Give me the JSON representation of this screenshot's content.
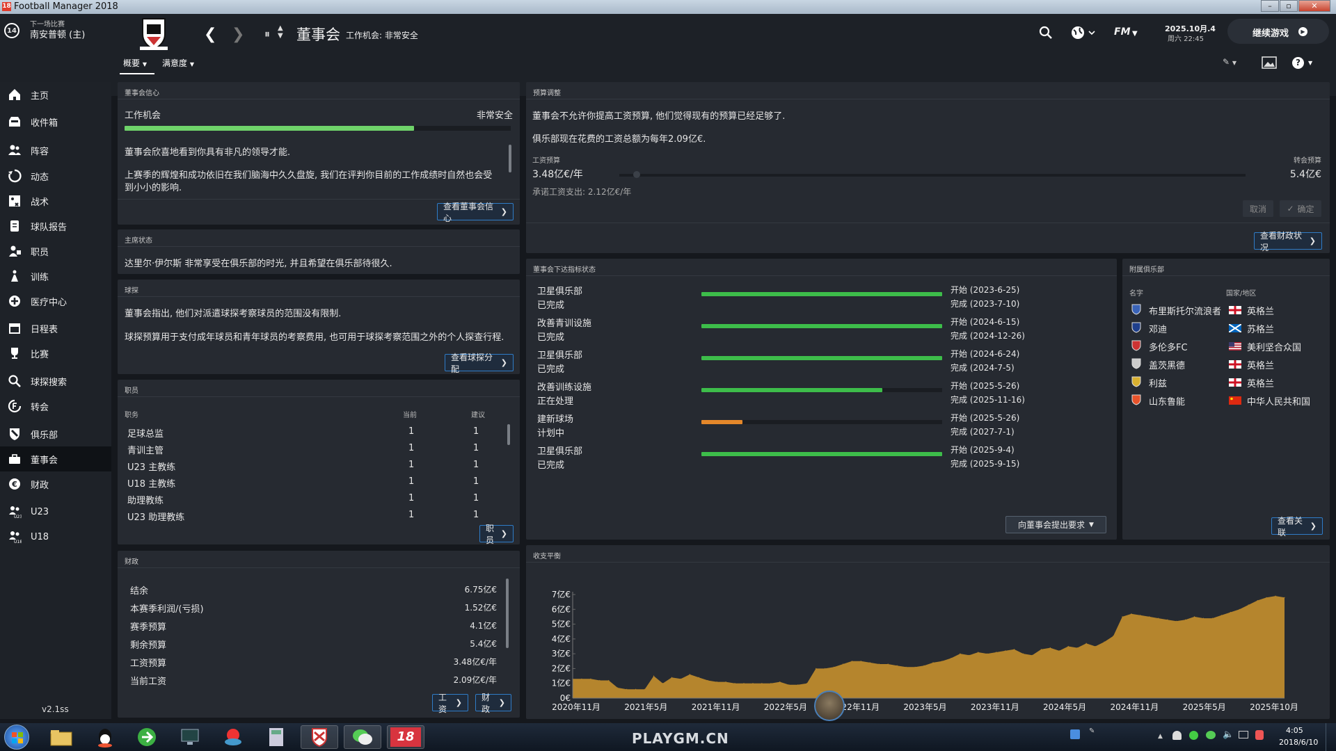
{
  "window": {
    "title": "Football Manager 2018",
    "logo": "18"
  },
  "header": {
    "next_match_label": "下一场比赛",
    "next_match_team": "南安普顿 (主)",
    "next_match_days": "14",
    "page_title": "董事会",
    "page_subtitle": "工作机会: 非常安全",
    "date": "2025.10月.4",
    "time": "周六 22:45",
    "fm_label": "FM",
    "continue_label": "继续游戏",
    "tabs": [
      {
        "label": "概要"
      },
      {
        "label": "满意度"
      }
    ]
  },
  "sidebar": {
    "items": [
      {
        "label": "主页",
        "icon": "home-icon"
      },
      {
        "label": "收件箱",
        "icon": "inbox-icon"
      },
      {
        "label": "阵容",
        "icon": "squad-icon"
      },
      {
        "label": "动态",
        "icon": "dynamics-icon"
      },
      {
        "label": "战术",
        "icon": "tactics-icon"
      },
      {
        "label": "球队报告",
        "icon": "report-icon"
      },
      {
        "label": "职员",
        "icon": "staff-icon"
      },
      {
        "label": "训练",
        "icon": "training-icon"
      },
      {
        "label": "医疗中心",
        "icon": "medical-icon"
      },
      {
        "label": "日程表",
        "icon": "calendar-icon"
      },
      {
        "label": "比赛",
        "icon": "trophy-icon"
      },
      {
        "label": "球探搜索",
        "icon": "search-icon"
      },
      {
        "label": "转会",
        "icon": "transfer-icon"
      },
      {
        "label": "俱乐部",
        "icon": "club-icon"
      },
      {
        "label": "董事会",
        "icon": "board-icon"
      },
      {
        "label": "财政",
        "icon": "finance-icon"
      },
      {
        "label": "U23",
        "icon": "u23-icon"
      },
      {
        "label": "U18",
        "icon": "u18-icon"
      }
    ],
    "version": "v2.1ss"
  },
  "confidence": {
    "title": "董事会信心",
    "job_label": "工作机会",
    "job_value": "非常安全",
    "progress": 0.75,
    "text1": "董事会欣喜地看到你具有非凡的领导才能.",
    "text2a": "上赛季的辉煌和成功依旧在我们脑海中久久盘旋, 我们在评判你目前的工作成绩时自然也会受",
    "text2b": "到小小的影响.",
    "button": "查看董事会信心"
  },
  "chairman": {
    "title": "主席状态",
    "text": "达里尔·伊尔斯 非常享受在俱乐部的时光, 并且希望在俱乐部待很久."
  },
  "scouting": {
    "title": "球探",
    "text1": "董事会指出, 他们对派遣球探考察球员的范围没有限制.",
    "text2": "球探预算用于支付成年球员和青年球员的考察费用, 也可用于球探考察范围之外的个人探查行程.",
    "button": "查看球探分配"
  },
  "staff": {
    "title": "职员",
    "col_role": "职务",
    "col_current": "当前",
    "col_suggest": "建议",
    "rows": [
      {
        "role": "足球总监",
        "current": "1",
        "suggest": "1"
      },
      {
        "role": "青训主管",
        "current": "1",
        "suggest": "1"
      },
      {
        "role": "U23 主教练",
        "current": "1",
        "suggest": "1"
      },
      {
        "role": "U18 主教练",
        "current": "1",
        "suggest": "1"
      },
      {
        "role": "助理教练",
        "current": "1",
        "suggest": "1"
      },
      {
        "role": "U23 助理教练",
        "current": "1",
        "suggest": "1"
      }
    ],
    "button": "职员"
  },
  "finance": {
    "title": "财政",
    "rows": [
      {
        "label": "结余",
        "value": "6.75亿€"
      },
      {
        "label": "本赛季利润/(亏损)",
        "value": "1.52亿€"
      },
      {
        "label": "赛季预算",
        "value": "4.1亿€"
      },
      {
        "label": "剩余预算",
        "value": "5.4亿€"
      },
      {
        "label": "工资预算",
        "value": "3.48亿€/年"
      },
      {
        "label": "当前工资",
        "value": "2.09亿€/年"
      }
    ],
    "btn_wage": "工资",
    "btn_finance": "财政"
  },
  "budget": {
    "title": "预算调整",
    "text1": "董事会不允许你提高工资预算, 他们觉得现有的预算已经足够了.",
    "text2": "俱乐部现在花费的工资总额为每年2.09亿€.",
    "wage_label": "工资预算",
    "transfer_label": "转会预算",
    "wage_value": "3.48亿€/年",
    "transfer_value": "5.4亿€",
    "committed": "承诺工资支出: 2.12亿€/年",
    "cancel": "取消",
    "confirm": "确定",
    "button": "查看财政状况"
  },
  "objectives": {
    "title": "董事会下达指标状态",
    "items": [
      {
        "name": "卫星俱乐部",
        "status": "已完成",
        "start": "开始 (2023-6-25)",
        "end": "完成 (2023-7-10)",
        "progress": 1.0,
        "color": "#3dbd4a"
      },
      {
        "name": "改善青训设施",
        "status": "已完成",
        "start": "开始 (2024-6-15)",
        "end": "完成 (2024-12-26)",
        "progress": 1.0,
        "color": "#3dbd4a"
      },
      {
        "name": "卫星俱乐部",
        "status": "已完成",
        "start": "开始 (2024-6-24)",
        "end": "完成 (2024-7-5)",
        "progress": 1.0,
        "color": "#3dbd4a"
      },
      {
        "name": "改善训练设施",
        "status": "正在处理",
        "start": "开始 (2025-5-26)",
        "end": "完成 (2025-11-16)",
        "progress": 0.75,
        "color": "#3dbd4a"
      },
      {
        "name": "建新球场",
        "status": "计划中",
        "start": "开始 (2025-5-26)",
        "end": "完成 (2027-7-1)",
        "progress": 0.17,
        "color": "#e4872a"
      },
      {
        "name": "卫星俱乐部",
        "status": "已完成",
        "start": "开始 (2025-9-4)",
        "end": "完成 (2025-9-15)",
        "progress": 1.0,
        "color": "#3dbd4a"
      }
    ],
    "button": "向董事会提出要求"
  },
  "affiliates": {
    "title": "附属俱乐部",
    "col_name": "名字",
    "col_nation": "国家/地区",
    "rows": [
      {
        "name": "布里斯托尔流浪者",
        "nation": "英格兰",
        "flag": "england"
      },
      {
        "name": "邓迪",
        "nation": "苏格兰",
        "flag": "scotland"
      },
      {
        "name": "多伦多FC",
        "nation": "美利坚合众国",
        "flag": "usa"
      },
      {
        "name": "盖茨黑德",
        "nation": "英格兰",
        "flag": "england"
      },
      {
        "name": "利兹",
        "nation": "英格兰",
        "flag": "england"
      },
      {
        "name": "山东鲁能",
        "nation": "中华人民共和国",
        "flag": "china"
      }
    ],
    "button": "查看关联"
  },
  "chart_data": {
    "type": "area",
    "title": "收支平衡",
    "y_ticks": [
      "0€",
      "1亿€",
      "2亿€",
      "3亿€",
      "4亿€",
      "5亿€",
      "6亿€",
      "7亿€"
    ],
    "ylim": [
      0,
      7
    ],
    "x_ticks": [
      "2020年11月",
      "2021年5月",
      "2021年11月",
      "2022年5月",
      "2022年11月",
      "2023年5月",
      "2023年11月",
      "2024年5月",
      "2024年11月",
      "2025年5月",
      "2025年10月"
    ],
    "color": "#b5852d",
    "values": [
      1.3,
      1.3,
      1.3,
      1.2,
      1.2,
      0.7,
      0.6,
      0.6,
      0.6,
      1.5,
      1.0,
      1.4,
      1.3,
      1.6,
      1.4,
      1.2,
      1.1,
      1.1,
      1.0,
      1.0,
      1.0,
      1.0,
      1.0,
      1.1,
      0.9,
      0.9,
      1.0,
      2.0,
      2.0,
      2.1,
      2.3,
      2.5,
      2.5,
      2.4,
      2.3,
      2.3,
      2.2,
      2.1,
      2.1,
      2.2,
      2.4,
      2.5,
      2.7,
      3.0,
      2.9,
      3.1,
      3.0,
      3.1,
      3.2,
      3.3,
      3.0,
      2.9,
      3.3,
      3.4,
      3.2,
      3.5,
      3.4,
      3.7,
      3.5,
      3.8,
      4.2,
      5.5,
      5.7,
      5.6,
      5.5,
      5.4,
      5.3,
      5.2,
      5.3,
      5.5,
      5.4,
      5.4,
      5.6,
      5.8,
      6.0,
      6.3,
      6.6,
      6.8,
      6.9,
      6.8
    ]
  },
  "taskbar": {
    "watermark": "PLAYGM.CN",
    "time": "4:05",
    "date": "2018/6/10"
  }
}
